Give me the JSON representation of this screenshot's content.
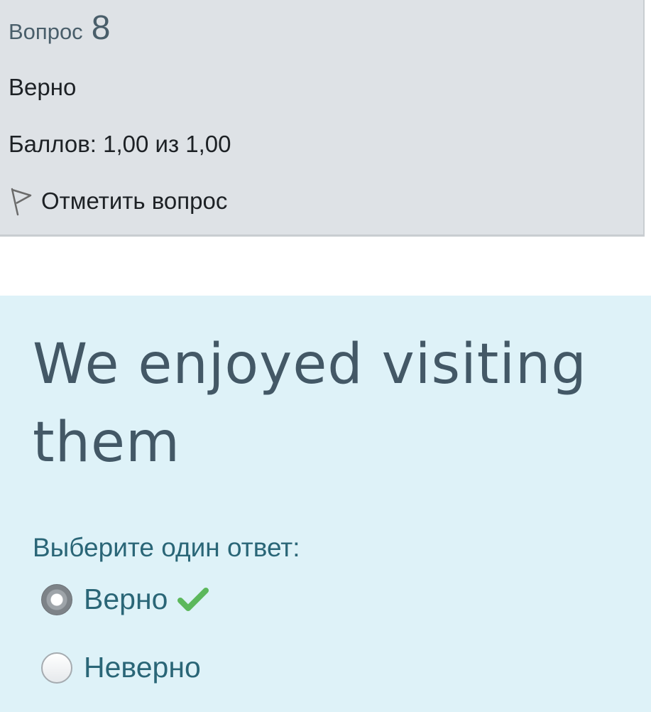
{
  "question_info": {
    "label": "Вопрос",
    "number": "8",
    "state": "Верно",
    "grade": "Баллов: 1,00 из 1,00",
    "flag_label": "Отметить вопрос"
  },
  "question": {
    "text": "We enjoyed visiting them",
    "prompt": "Выберите один ответ:",
    "options": [
      {
        "label": "Верно",
        "selected": true,
        "correct": true
      },
      {
        "label": "Неверно",
        "selected": false
      }
    ]
  },
  "colors": {
    "info_background": "#dee2e6",
    "content_background": "#def2f8",
    "heading_text": "#435866",
    "option_text": "#2a6677",
    "correct_check": "#5cb85c"
  },
  "icons": {
    "flag": "flag-icon",
    "correct": "check-icon"
  }
}
